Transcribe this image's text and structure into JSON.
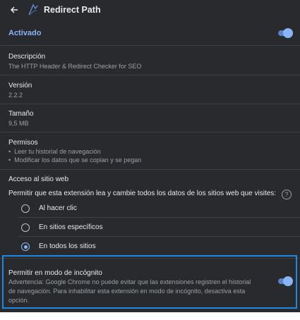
{
  "header": {
    "title": "Redirect Path"
  },
  "enabled": {
    "label": "Activado",
    "on": true
  },
  "description": {
    "title": "Descripción",
    "value": "The HTTP Header & Redirect Checker for SEO"
  },
  "version": {
    "title": "Versión",
    "value": "2.2.2"
  },
  "size": {
    "title": "Tamaño",
    "value": "9,5 MB"
  },
  "permissions": {
    "title": "Permisos",
    "items": [
      "Leer tu historial de navegación",
      "Modificar los datos que se copian y se pegan"
    ]
  },
  "site_access": {
    "title": "Acceso al sitio web",
    "description": "Permitir que esta extensión lea y cambie todos los datos de los sitios web que visites:",
    "help": "?",
    "options": [
      {
        "label": "Al hacer clic",
        "selected": false
      },
      {
        "label": "En sitios específicos",
        "selected": false
      },
      {
        "label": "En todos los sitios",
        "selected": true
      }
    ]
  },
  "incognito": {
    "title": "Permitir en modo de incógnito",
    "warning": "Advertencia: Google Chrome no puede evitar que las extensiones registren el historial de navegación. Para inhabilitar esta extensión en modo de incógnito, desactiva esta opción.",
    "on": true
  },
  "colors": {
    "background": "#292a2d",
    "accent": "#8ab4f8",
    "highlight_border": "#1e88e5"
  }
}
